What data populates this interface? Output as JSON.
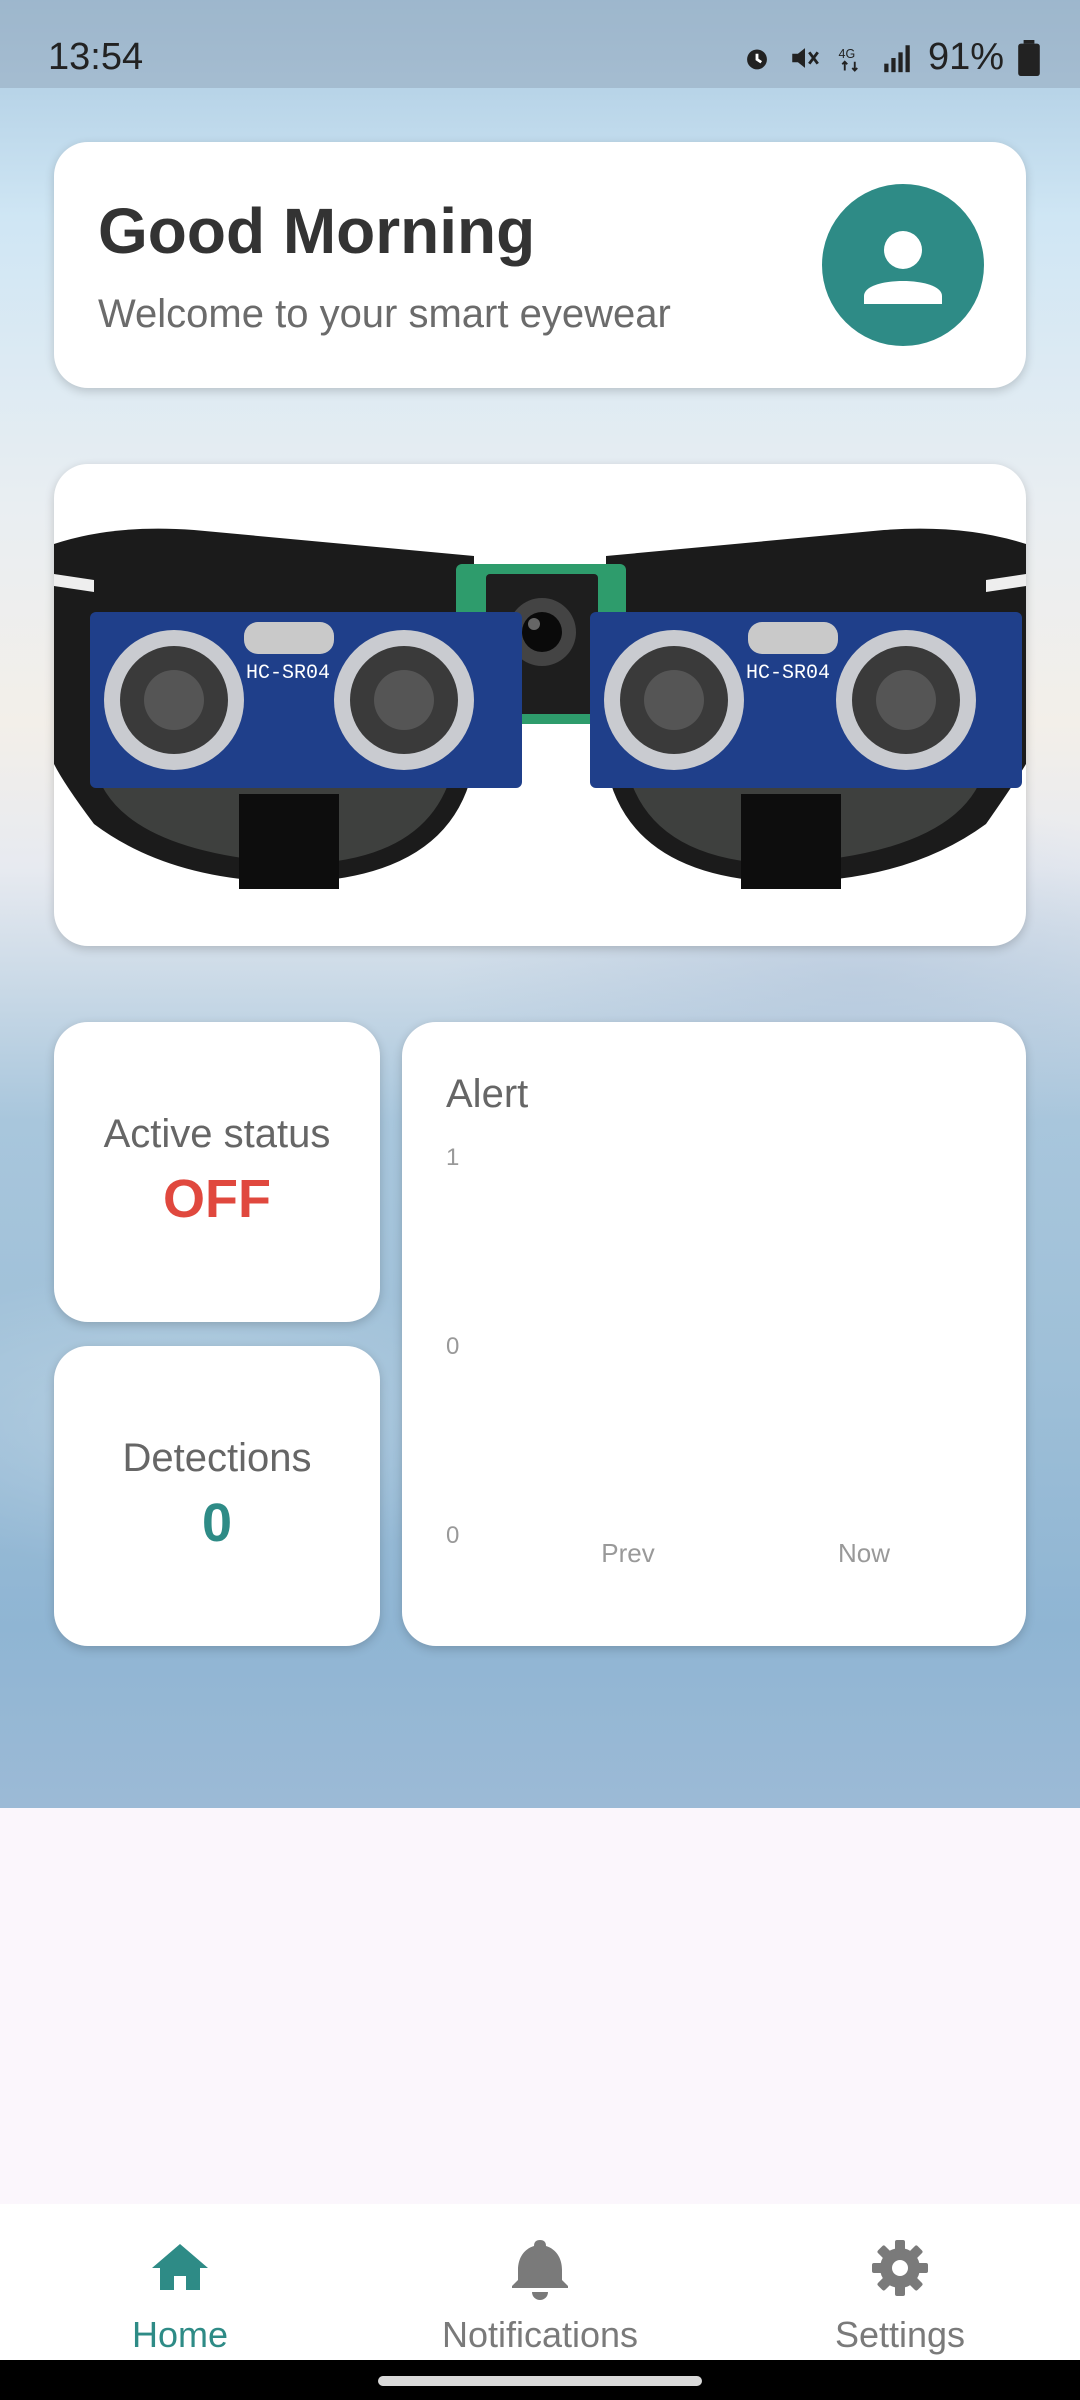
{
  "status_bar": {
    "time": "13:54",
    "battery": "91%"
  },
  "greeting": {
    "title": "Good Morning",
    "subtitle": "Welcome to your smart eyewear",
    "avatar_icon": "person-icon"
  },
  "device_image": {
    "labels": [
      "HC-SR04",
      "HC-SR04"
    ]
  },
  "active_status": {
    "label": "Active status",
    "value": "OFF",
    "color": "#e0483e"
  },
  "detections": {
    "label": "Detections",
    "value": "0",
    "color": "#2e8b86"
  },
  "chart_data": {
    "type": "line",
    "title": "Alert",
    "categories": [
      "Prev",
      "Now"
    ],
    "y_tick_labels": [
      "1",
      "0",
      "0"
    ],
    "series": [],
    "grid": false
  },
  "nav": {
    "items": [
      {
        "label": "Home",
        "icon": "home-icon",
        "active": true
      },
      {
        "label": "Notifications",
        "icon": "bell-icon",
        "active": false
      },
      {
        "label": "Settings",
        "icon": "gear-icon",
        "active": false
      }
    ],
    "active_color": "#2e8b86",
    "inactive_color": "#7a7a7a"
  }
}
